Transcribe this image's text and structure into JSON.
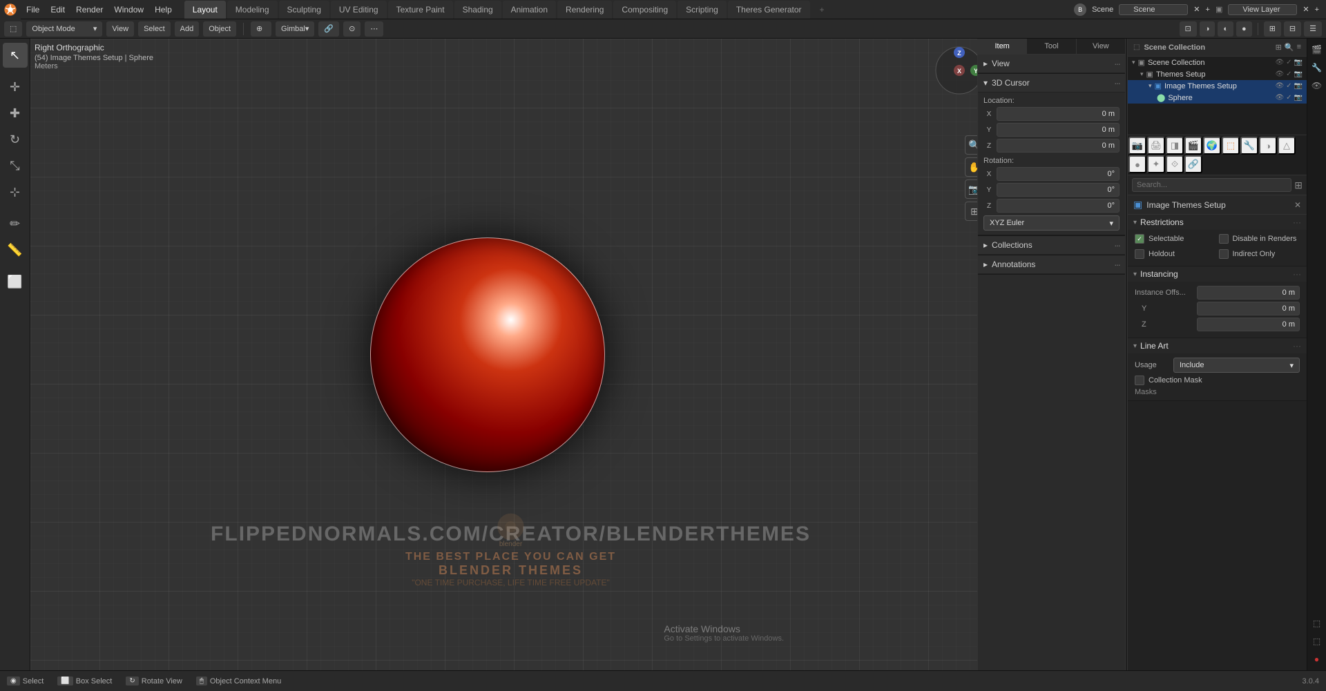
{
  "app": {
    "title": "Blender",
    "version": "3.0.4"
  },
  "topbar": {
    "menus": [
      "File",
      "Edit",
      "Render",
      "Window",
      "Help"
    ],
    "workspaces": [
      "Layout",
      "Modeling",
      "Sculpting",
      "UV Editing",
      "Texture Paint",
      "Shading",
      "Animation",
      "Rendering",
      "Compositing",
      "Scripting",
      "Theres Generator"
    ],
    "active_workspace": "Layout",
    "scene_label": "Scene",
    "view_layer_label": "View Layer"
  },
  "header": {
    "mode": "Object Mode",
    "view": "View",
    "select": "Select",
    "add": "Add",
    "object": "Object",
    "transform": "Gimbal",
    "plus_icon": "+"
  },
  "viewport": {
    "view_name": "Right Orthographic",
    "scene_info": "(54) Image Themes Setup | Sphere",
    "units": "Meters",
    "watermark_url": "FLIPPEDNORMALS.COM/CREATOR/BLENDERTHEMES",
    "watermark_line1": "THE BEST PLACE YOU CAN GET",
    "watermark_line2": "BLENDER THEMES",
    "watermark_line3": "\"ONE TIME PURCHASE, LIFE TIME FREE UPDATE\""
  },
  "gizmo": {
    "x": "X",
    "y": "Y",
    "z": "Z"
  },
  "n_panel": {
    "tabs": [
      "Item",
      "Tool",
      "View"
    ],
    "sections": {
      "view": {
        "label": "View",
        "expanded": true
      },
      "cursor_3d": {
        "label": "3D Cursor",
        "expanded": true,
        "location": {
          "x": {
            "label": "X",
            "value": "0 m"
          },
          "y": {
            "label": "Y",
            "value": "0 m"
          },
          "z": {
            "label": "Z",
            "value": "0 m"
          }
        },
        "rotation": {
          "x": {
            "label": "X",
            "value": "0°"
          },
          "y": {
            "label": "Y",
            "value": "0°"
          },
          "z": {
            "label": "Z",
            "value": "0°"
          }
        },
        "rotation_mode": "XYZ Euler"
      },
      "collections": {
        "label": "Collections",
        "expanded": false
      },
      "annotations": {
        "label": "Annotations",
        "expanded": false
      }
    }
  },
  "outliner": {
    "title": "Scene Collection",
    "items": [
      {
        "label": "Themes Setup",
        "indent": 0,
        "icon": "collection",
        "children": [
          {
            "label": "Image Themes Setup",
            "indent": 1,
            "icon": "collection",
            "active": true,
            "children": [
              {
                "label": "Sphere",
                "indent": 2,
                "icon": "mesh",
                "selected": true
              }
            ]
          }
        ]
      }
    ]
  },
  "properties_panel": {
    "title": "Image Themes Setup",
    "sections": {
      "restrictions": {
        "label": "Restrictions",
        "expanded": true,
        "checkboxes": [
          {
            "label": "Selectable",
            "checked": true
          },
          {
            "label": "Disable in Renders",
            "checked": false
          },
          {
            "label": "Holdout",
            "checked": false
          },
          {
            "label": "Indirect Only",
            "checked": false
          }
        ]
      },
      "instancing": {
        "label": "Instancing",
        "expanded": true,
        "fields": [
          {
            "label": "Instance Offs...",
            "axis": "",
            "value": "0 m"
          },
          {
            "label": "",
            "axis": "Y",
            "value": "0 m"
          },
          {
            "label": "",
            "axis": "Z",
            "value": "0 m"
          }
        ]
      },
      "line_art": {
        "label": "Line Art",
        "expanded": true,
        "usage_label": "Usage",
        "usage_value": "Include",
        "checkboxes": [
          {
            "label": "Collection Mask",
            "checked": false
          }
        ],
        "masks_label": "Masks"
      }
    }
  },
  "status_bar": {
    "items": [
      {
        "key": "Select",
        "action": "Select"
      },
      {
        "key": "Box Select",
        "action": "Box Select"
      },
      {
        "key": "Rotate View",
        "action": "Rotate View"
      },
      {
        "key": "Object Context Menu",
        "action": "Object Context Menu"
      }
    ],
    "version": "3.0.4"
  },
  "icons": {
    "arrow_right": "▶",
    "arrow_down": "▼",
    "dots": "···",
    "check": "✓",
    "sphere_mesh": "⬤",
    "collection": "▣",
    "search": "🔍",
    "pin": "📌",
    "close": "✕",
    "filter": "⊞",
    "chevron_down": "▾",
    "chevron_right": "▸"
  },
  "activate_windows": {
    "line1": "Activate Windows",
    "line2": "Go to Settings to activate Windows."
  }
}
